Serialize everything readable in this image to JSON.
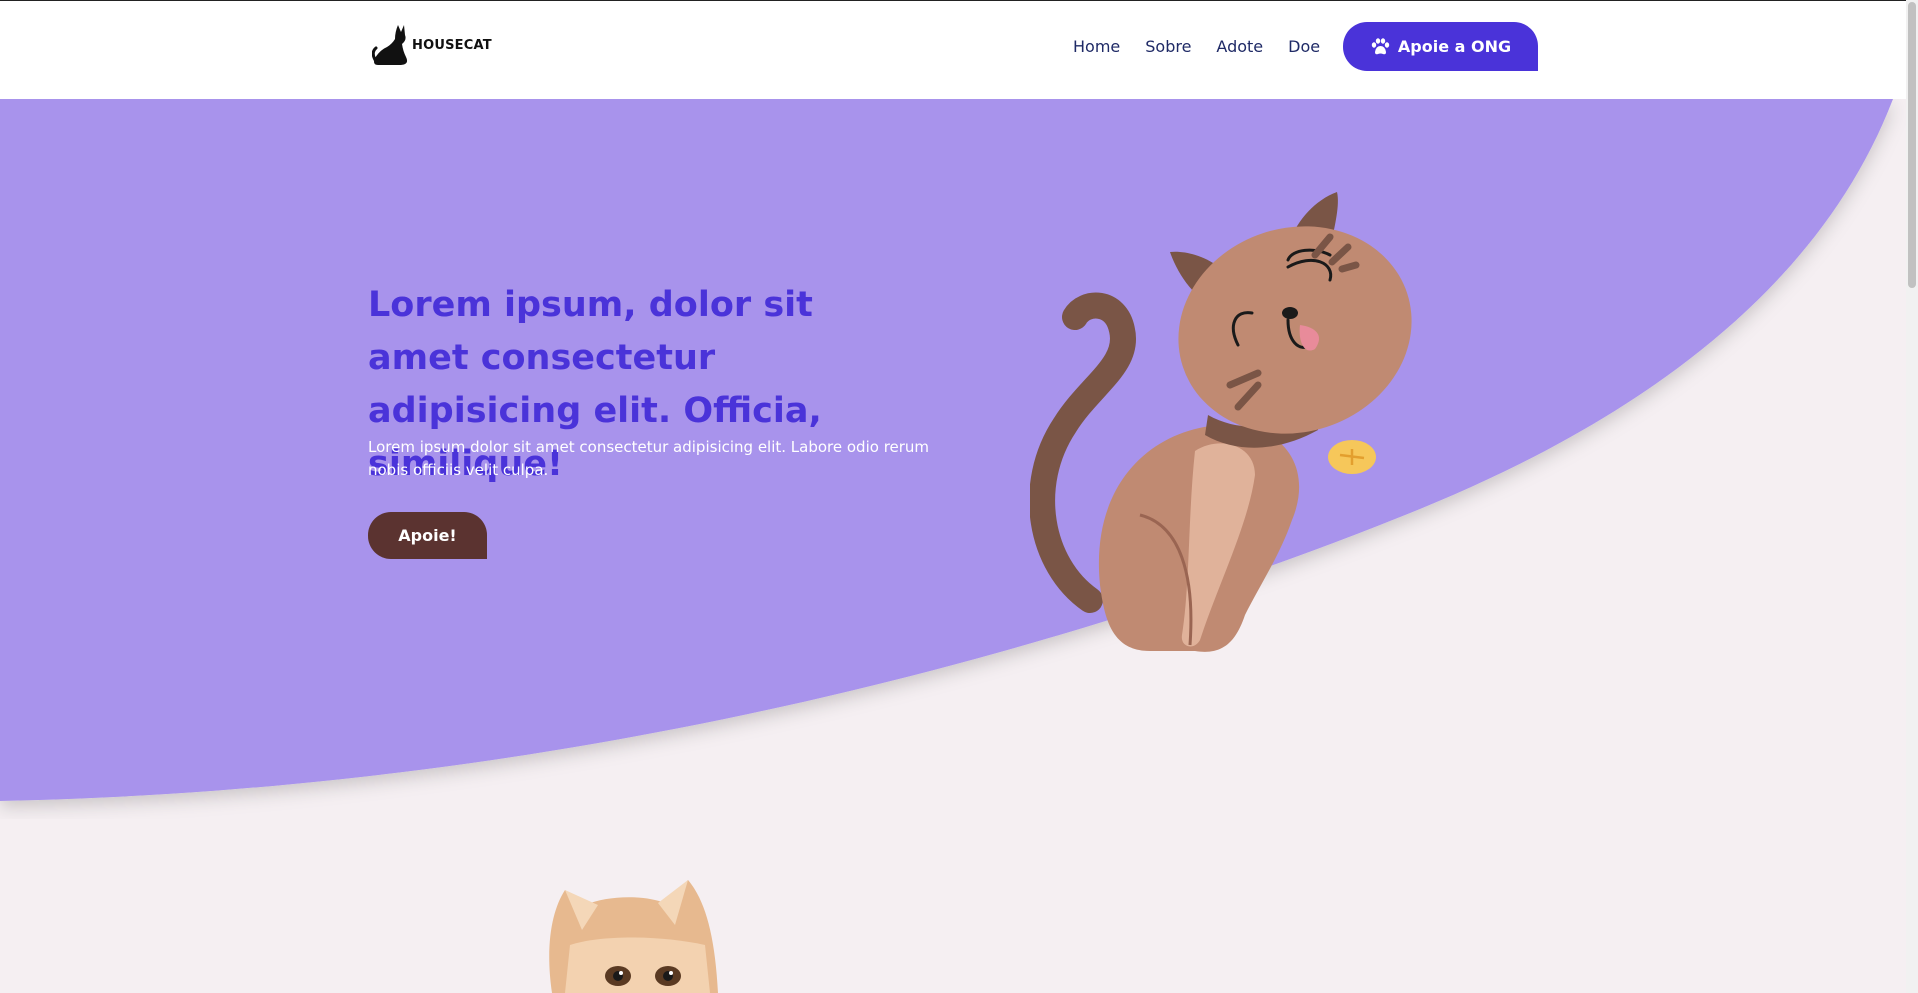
{
  "brand": {
    "name": "HOUSECAT"
  },
  "nav": {
    "links": [
      {
        "label": "Home"
      },
      {
        "label": "Sobre"
      },
      {
        "label": "Adote"
      },
      {
        "label": "Doe"
      }
    ],
    "cta_label": "Apoie a ONG",
    "cta_icon": "paw-icon"
  },
  "hero": {
    "title": "Lorem ipsum, dolor sit amet consectetur adipisicing elit. Officia, similique!",
    "subtitle": "Lorem ipsum dolor sit amet consectetur adipisicing elit. Labore odio rerum nobis officiis velit culpa.",
    "button_label": "Apoie!"
  },
  "colors": {
    "accent": "#4a33d9",
    "hero_bg": "#a893ec",
    "page_bg": "#f5eff2",
    "button_dark": "#5b3330"
  }
}
